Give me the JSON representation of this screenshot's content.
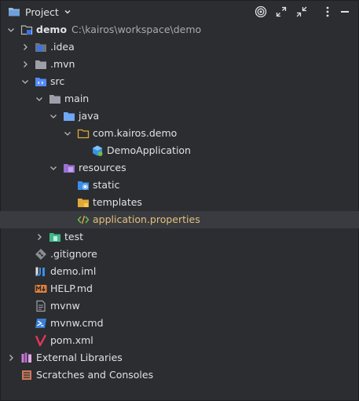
{
  "header": {
    "title": "Project",
    "icons": [
      "folder-icon",
      "chevron-down-icon",
      "locate-file-icon",
      "expand-all-icon",
      "collapse-all-icon",
      "more-options-icon",
      "hide-icon"
    ]
  },
  "tree": {
    "root_name": "demo",
    "root_path": "C:\\kairos\\workspace\\demo",
    "idea": ".idea",
    "mvn": ".mvn",
    "src": "src",
    "main": "main",
    "java": "java",
    "package": "com.kairos.demo",
    "demo_application": "DemoApplication",
    "resources": "resources",
    "static": "static",
    "templates": "templates",
    "application_properties": "application.properties",
    "test": "test",
    "gitignore": ".gitignore",
    "demo_iml": "demo.iml",
    "help_md": "HELP.md",
    "mvnw": "mvnw",
    "mvnw_cmd": "mvnw.cmd",
    "pom_xml": "pom.xml",
    "external_libraries": "External Libraries",
    "scratches": "Scratches and Consoles"
  },
  "colors": {
    "background": "#2b2d30",
    "selected_row": "#393b40",
    "text": "#dfe1e5",
    "path_text": "#a8abb1",
    "highlight_text": "#e5c07b"
  }
}
